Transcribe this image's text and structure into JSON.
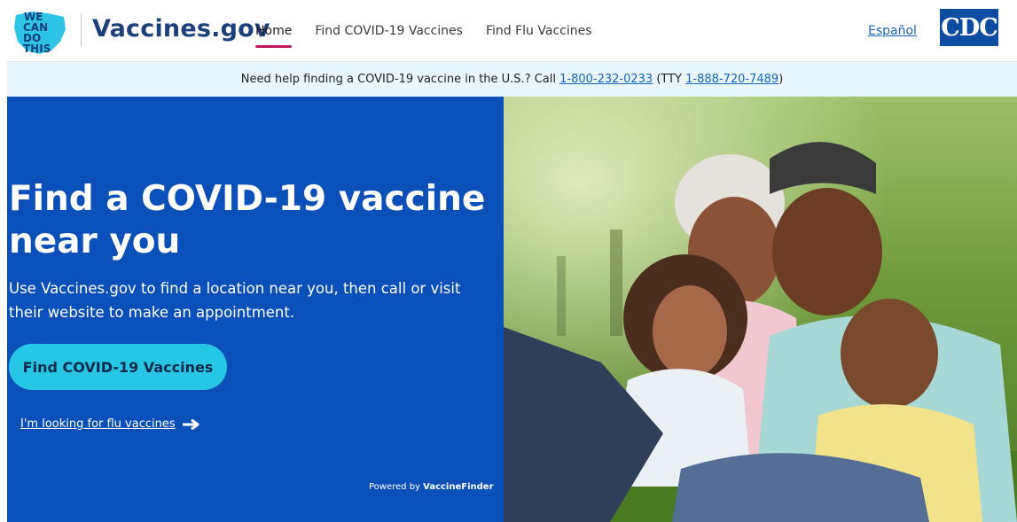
{
  "header": {
    "logo_lines": [
      "WE",
      "CAN",
      "DO",
      "THIS"
    ],
    "brand": "Vaccines.gov",
    "nav": [
      {
        "label": "Home",
        "active": true
      },
      {
        "label": "Find COVID-19 Vaccines",
        "active": false
      },
      {
        "label": "Find Flu Vaccines",
        "active": false
      }
    ],
    "language_link": "Español",
    "cdc_logo_text": "CDC"
  },
  "helpbar": {
    "prefix": "Need help finding a COVID-19 vaccine in the U.S.? Call ",
    "phone": "1-800-232-0233",
    "tty_prefix": " (TTY ",
    "tty_phone": "1-888-720-7489",
    "suffix": ")"
  },
  "hero": {
    "title": "Find a COVID-19 vaccine near you",
    "subtitle": "Use Vaccines.gov to find a location near you, then call or visit their website to make an appointment.",
    "cta_label": "Find COVID-19 Vaccines",
    "flu_link": "I'm looking for flu vaccines",
    "powered_prefix": "Powered by ",
    "powered_brand": "VaccineFinder"
  },
  "colors": {
    "brand_blue": "#1d3f7a",
    "hero_blue": "#0b4fb8",
    "cta_cyan": "#26c6e4",
    "accent_pink": "#c2185b",
    "helpbar_bg": "#e9f6fb"
  }
}
